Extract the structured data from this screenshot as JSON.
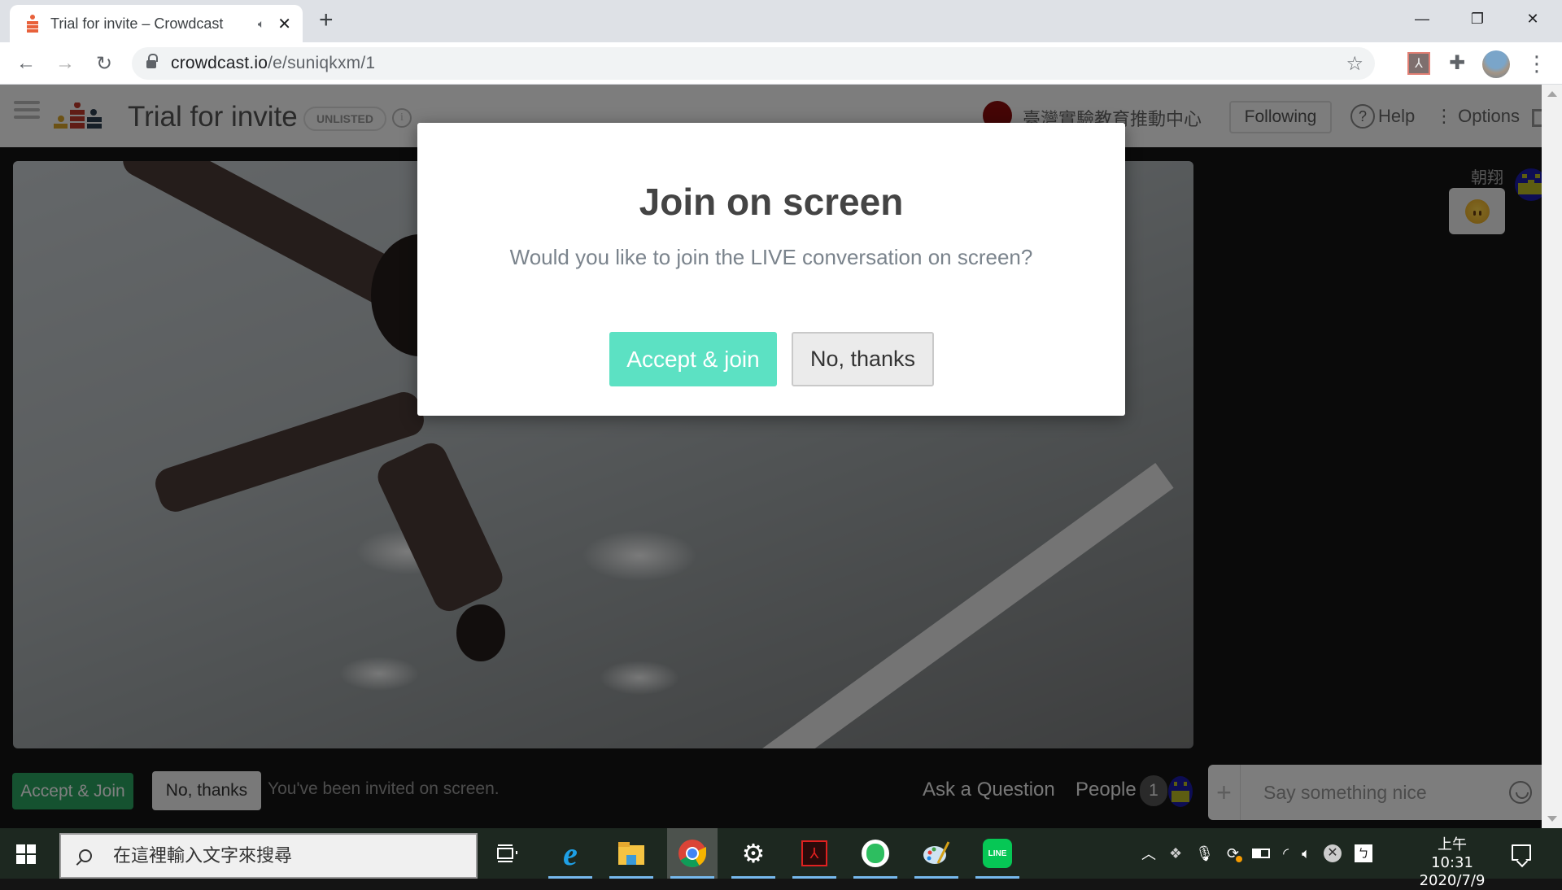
{
  "browser": {
    "tab": {
      "title": "Trial for invite – Crowdcast",
      "audio_icon": "speaker-icon",
      "close_label": "✕"
    },
    "new_tab_label": "+",
    "window_controls": {
      "minimize": "—",
      "restore": "❐",
      "close": "✕"
    },
    "nav": {
      "back": "←",
      "forward": "→",
      "reload": "↻"
    },
    "address": {
      "host": "crowdcast.io",
      "path": "/e/suniqkxm/1"
    },
    "bookmark_icon": "☆",
    "extensions": [
      "acrobat-extension-icon",
      "extensions-puzzle-icon"
    ],
    "menu_icon": "⋮"
  },
  "header": {
    "title": "Trial for invite",
    "badge": "UNLISTED",
    "info_icon": "i",
    "organizer": "臺灣實驗教育推動中心",
    "following_label": "Following",
    "help_label": "Help",
    "help_icon": "?",
    "options_label": "Options",
    "options_icon": "⋮"
  },
  "chat": {
    "messages": [
      {
        "author": "朝翔",
        "content_type": "emoji",
        "emoji": "upside-down-face"
      }
    ],
    "input_placeholder": "Say something nice",
    "add_icon": "+"
  },
  "bottom_bar": {
    "accept_label": "Accept & Join",
    "decline_label": "No, thanks",
    "invite_message": "You've been invited on screen.",
    "ask_question_label": "Ask a Question",
    "people_label": "People",
    "people_count": "1"
  },
  "modal": {
    "title": "Join on screen",
    "text": "Would you like to join the LIVE conversation on screen?",
    "accept_label": "Accept & join",
    "decline_label": "No, thanks"
  },
  "taskbar": {
    "search_placeholder": "在這裡輸入文字來搜尋",
    "apps": [
      "task-view",
      "internet-explorer",
      "file-explorer",
      "chrome",
      "settings",
      "acrobat-reader",
      "evernote",
      "paint",
      "line"
    ],
    "clock": {
      "time": "上午 10:31",
      "date": "2020/7/9"
    }
  },
  "colors": {
    "modal_accept": "#5ce1c3",
    "bar_accept": "#2aa561",
    "crowdcast_orange": "#e8613b"
  }
}
